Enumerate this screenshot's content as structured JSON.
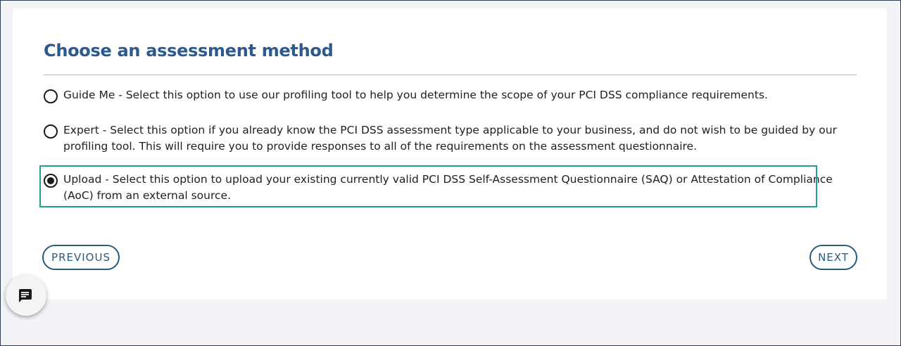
{
  "section": {
    "title": "Choose an assessment method"
  },
  "options": [
    {
      "label": "Guide Me - Select this option to use our profiling tool to help you determine the scope of your PCI DSS compliance requirements.",
      "selected": false
    },
    {
      "label": "Expert - Select this option if you already know the PCI DSS assessment type applicable to your business, and do not wish to be guided by our profiling tool. This will require you to provide responses to all of the requirements on the assessment questionnaire.",
      "selected": false
    },
    {
      "label": "Upload - Select this option to upload your existing currently valid PCI DSS Self-Assessment Questionnaire (SAQ) or Attestation of Compliance (AoC) from an external source.",
      "selected": true
    }
  ],
  "nav": {
    "previous_label": "PREVIOUS",
    "next_label": "NEXT"
  },
  "chat_widget": {
    "icon": "chat-bubble-icon"
  },
  "colors": {
    "title": "#2b5a8e",
    "highlight": "#1f9e96",
    "button": "#2b5a7a"
  }
}
